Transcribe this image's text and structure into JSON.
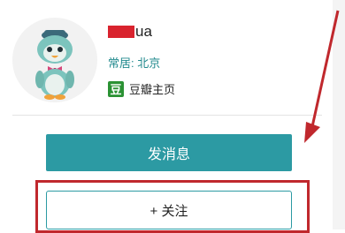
{
  "profile": {
    "name_suffix": "ua",
    "location": "常居: 北京",
    "home_link": "豆瓣主页",
    "douban_logo_char": "豆",
    "avatar_icon": "cartoon-penguin-avatar"
  },
  "actions": {
    "message_label": "发消息",
    "follow_label": "+ 关注"
  },
  "colors": {
    "accent": "#2c9aa3",
    "location_text": "#228a8e",
    "douban_green": "#2b9234",
    "annotation_red": "#c0282d",
    "redaction_red": "#d9232e"
  }
}
